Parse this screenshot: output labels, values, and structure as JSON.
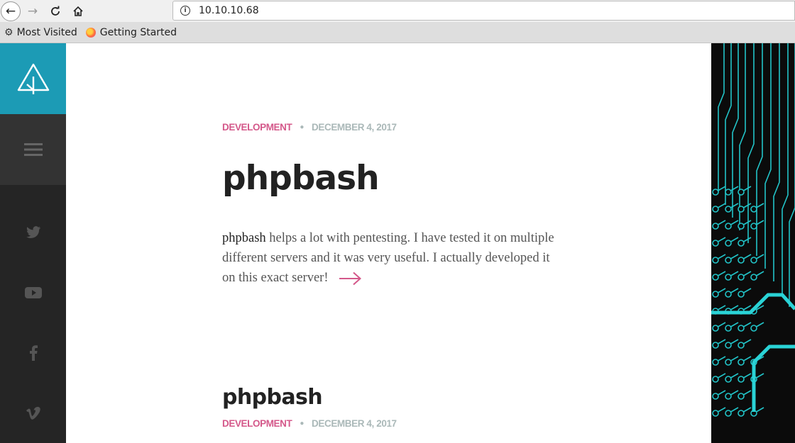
{
  "browser": {
    "url": "10.10.10.68",
    "bookmarks": [
      "Most Visited",
      "Getting Started"
    ]
  },
  "sidebar": {
    "accent_color": "#1c9bb5",
    "social_icons": [
      "twitter-icon",
      "youtube-icon",
      "facebook-icon",
      "vimeo-icon"
    ]
  },
  "posts": [
    {
      "category": "DEVELOPMENT",
      "date": "DECEMBER 4, 2017",
      "title": "phpbash",
      "excerpt_lead": "phpbash",
      "excerpt_rest": " helps a lot with pentesting. I have tested it on multiple different servers and it was very useful. I actually developed it on this exact server!"
    },
    {
      "title": "phpbash",
      "category": "DEVELOPMENT",
      "date": "DECEMBER 4, 2017"
    }
  ],
  "colors": {
    "category": "#d4588a",
    "date": "#aab8b8",
    "circuit": "#22c4c8"
  }
}
